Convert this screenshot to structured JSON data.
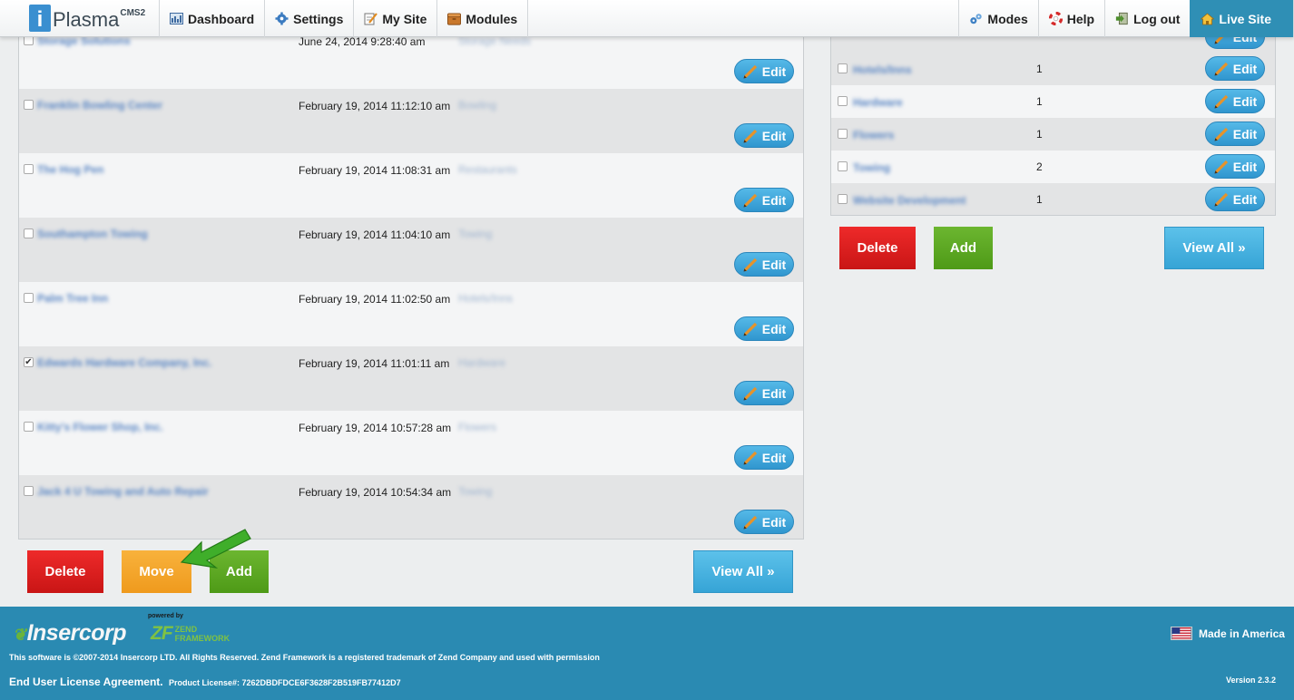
{
  "app": {
    "logo_letter": "i",
    "logo_name": "Plasma",
    "logo_suffix": "CMS2"
  },
  "nav": {
    "left": [
      {
        "label": "Dashboard",
        "icon": "dashboard-icon"
      },
      {
        "label": "Settings",
        "icon": "gear-icon"
      },
      {
        "label": "My Site",
        "icon": "notepad-icon"
      },
      {
        "label": "Modules",
        "icon": "box-icon"
      }
    ],
    "right": [
      {
        "label": "Modes",
        "icon": "gears-icon"
      },
      {
        "label": "Help",
        "icon": "lifebuoy-icon"
      },
      {
        "label": "Log out",
        "icon": "door-icon"
      },
      {
        "label": "Live Site",
        "icon": "home-icon"
      }
    ]
  },
  "listing": {
    "rows": [
      {
        "name": "Storage Solutions",
        "date": "June 24, 2014 9:28:40 am",
        "category": "Storage Needs",
        "checked": false
      },
      {
        "name": "Franklin Bowling Center",
        "date": "February 19, 2014 11:12:10 am",
        "category": "Bowling",
        "checked": false
      },
      {
        "name": "The Hog Pen",
        "date": "February 19, 2014 11:08:31 am",
        "category": "Restaurants",
        "checked": false
      },
      {
        "name": "Southampton Towing",
        "date": "February 19, 2014 11:04:10 am",
        "category": "Towing",
        "checked": false
      },
      {
        "name": "Palm Tree Inn",
        "date": "February 19, 2014 11:02:50 am",
        "category": "Hotels/Inns",
        "checked": false
      },
      {
        "name": "Edwards Hardware Company, Inc.",
        "date": "February 19, 2014 11:01:11 am",
        "category": "Hardware",
        "checked": true
      },
      {
        "name": "Kitty's Flower Shop, Inc.",
        "date": "February 19, 2014 10:57:28 am",
        "category": "Flowers",
        "checked": false
      },
      {
        "name": "Jack 4 U Towing and Auto Repair",
        "date": "February 19, 2014 10:54:34 am",
        "category": "Towing",
        "checked": false
      }
    ],
    "edit_label": "Edit",
    "delete_label": "Delete",
    "move_label": "Move",
    "add_label": "Add",
    "view_all_label": "View All »"
  },
  "categories": {
    "rows": [
      {
        "name": "Hotels/Inns",
        "count": "1"
      },
      {
        "name": "Hardware",
        "count": "1"
      },
      {
        "name": "Flowers",
        "count": "1"
      },
      {
        "name": "Towing",
        "count": "2"
      },
      {
        "name": "Website Development",
        "count": "1"
      }
    ],
    "edit_label": "Edit",
    "delete_label": "Delete",
    "add_label": "Add",
    "view_all_label": "View All »"
  },
  "footer": {
    "company": "Insercorp",
    "powered_by": "powered by",
    "zf_mark": "ZF",
    "zf_line1": "ZEND",
    "zf_line2": "FRAMEWORK",
    "copyright": "This software is ©2007-2014 Insercorp LTD. All Rights Reserved. Zend Framework is a registered trademark of Zend Company and used with permission",
    "eula": "End User License Agreement.",
    "license": "Product License#: 7262DBDFDCE6F3628F2B519FB77412D7",
    "made_in": "Made in America",
    "version": "Version 2.3.2"
  }
}
